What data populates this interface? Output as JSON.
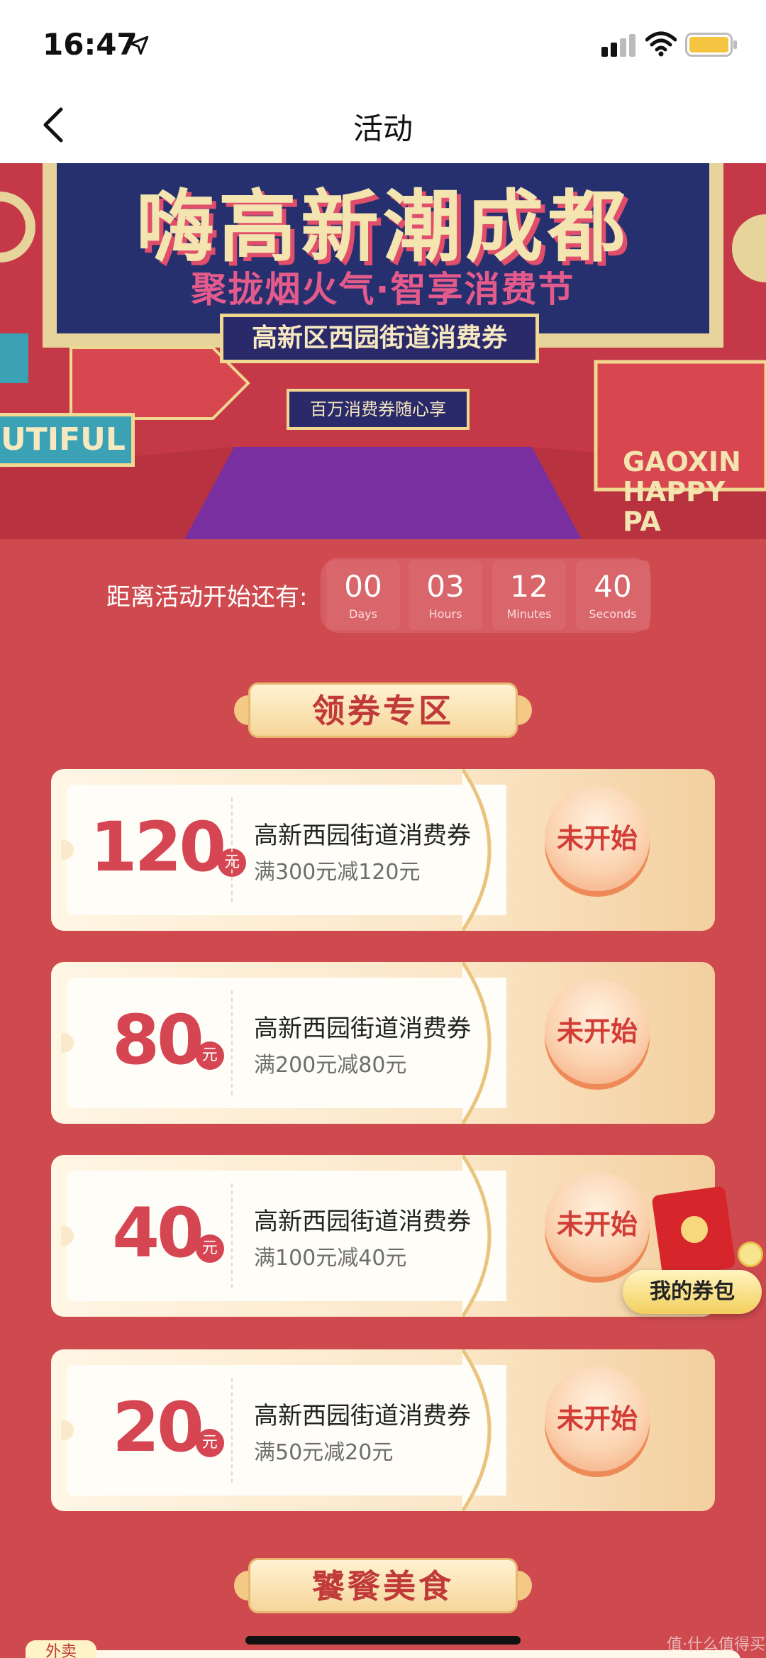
{
  "status": {
    "time": "16:47"
  },
  "nav": {
    "title": "活动"
  },
  "banner": {
    "title": "嗨高新潮成都",
    "slogan": "聚拢烟火气·智享消费节",
    "subtitle": "高新区西园街道消费券",
    "tagline": "百万消费券随心享",
    "side_left": "UTIFUL",
    "side_right_line1": "GAOXIN",
    "side_right_line2": "HAPPY PA"
  },
  "countdown": {
    "label": "距离活动开始还有:",
    "units": [
      {
        "value": "00",
        "unit": "Days"
      },
      {
        "value": "03",
        "unit": "Hours"
      },
      {
        "value": "12",
        "unit": "Minutes"
      },
      {
        "value": "40",
        "unit": "Seconds"
      }
    ]
  },
  "sections": {
    "coupons_title": "领券专区",
    "food_title": "饕餮美食",
    "food_tab": "外卖"
  },
  "coupon_unit": "元",
  "coupons": [
    {
      "amount": "120",
      "name": "高新西园街道消费券",
      "rule": "满300元减120元",
      "button": "未开始"
    },
    {
      "amount": "80",
      "name": "高新西园街道消费券",
      "rule": "满200元减80元",
      "button": "未开始"
    },
    {
      "amount": "40",
      "name": "高新西园街道消费券",
      "rule": "满100元减40元",
      "button": "未开始"
    },
    {
      "amount": "20",
      "name": "高新西园街道消费券",
      "rule": "满50元减20元",
      "button": "未开始"
    }
  ],
  "wallet": {
    "label": "我的券包"
  },
  "watermark": "值·什么值得买",
  "colors": {
    "background": "#cf4a4e",
    "accent": "#d54552",
    "button_text": "#d23d36"
  }
}
